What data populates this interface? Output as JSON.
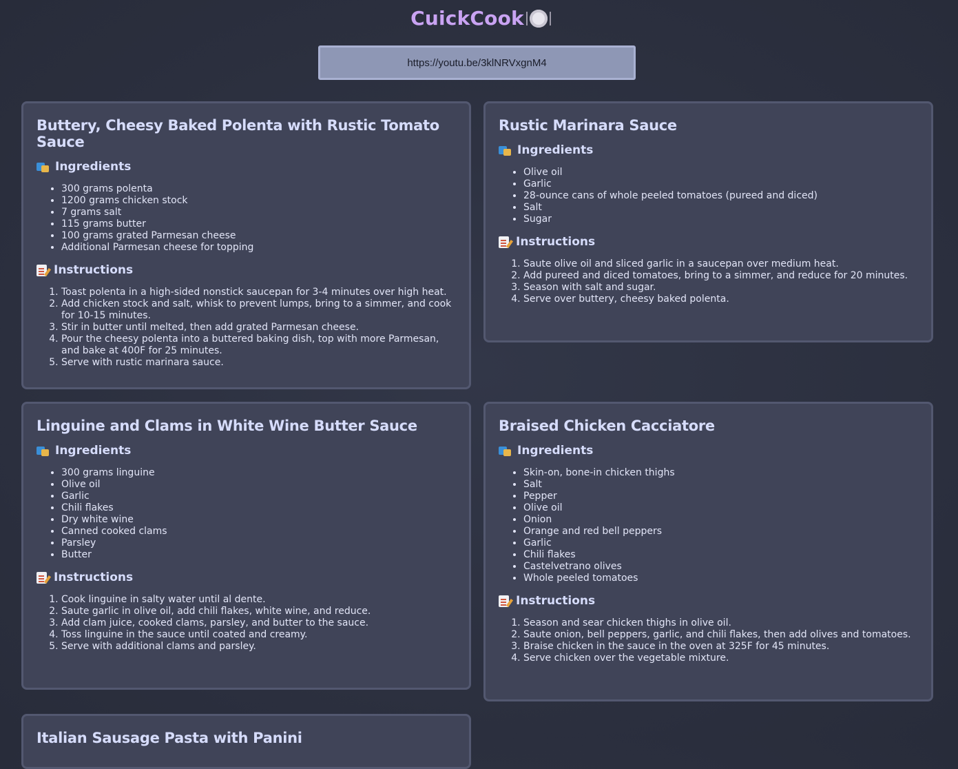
{
  "app": {
    "title": "CuickCook"
  },
  "url_input": {
    "value": "https://youtu.be/3klNRVxgnM4"
  },
  "labels": {
    "ingredients": "Ingredients",
    "instructions": "Instructions"
  },
  "recipes": [
    {
      "title": "Buttery, Cheesy Baked Polenta with Rustic Tomato Sauce",
      "ingredients": [
        "300 grams polenta",
        "1200 grams chicken stock",
        "7 grams salt",
        "115 grams butter",
        "100 grams grated Parmesan cheese",
        "Additional Parmesan cheese for topping"
      ],
      "instructions": [
        "Toast polenta in a high-sided nonstick saucepan for 3-4 minutes over high heat.",
        "Add chicken stock and salt, whisk to prevent lumps, bring to a simmer, and cook for 10-15 minutes.",
        "Stir in butter until melted, then add grated Parmesan cheese.",
        "Pour the cheesy polenta into a buttered baking dish, top with more Parmesan, and bake at 400F for 25 minutes.",
        "Serve with rustic marinara sauce."
      ]
    },
    {
      "title": "Rustic Marinara Sauce",
      "ingredients": [
        "Olive oil",
        "Garlic",
        "28-ounce cans of whole peeled tomatoes (pureed and diced)",
        "Salt",
        "Sugar"
      ],
      "instructions": [
        "Saute olive oil and sliced garlic in a saucepan over medium heat.",
        "Add pureed and diced tomatoes, bring to a simmer, and reduce for 20 minutes.",
        "Season with salt and sugar.",
        "Serve over buttery, cheesy baked polenta."
      ]
    },
    {
      "title": "Linguine and Clams in White Wine Butter Sauce",
      "ingredients": [
        "300 grams linguine",
        "Olive oil",
        "Garlic",
        "Chili flakes",
        "Dry white wine",
        "Canned cooked clams",
        "Parsley",
        "Butter"
      ],
      "instructions": [
        "Cook linguine in salty water until al dente.",
        "Saute garlic in olive oil, add chili flakes, white wine, and reduce.",
        "Add clam juice, cooked clams, parsley, and butter to the sauce.",
        "Toss linguine in the sauce until coated and creamy.",
        "Serve with additional clams and parsley."
      ]
    },
    {
      "title": "Braised Chicken Cacciatore",
      "ingredients": [
        "Skin-on, bone-in chicken thighs",
        "Salt",
        "Pepper",
        "Olive oil",
        "Onion",
        "Orange and red bell peppers",
        "Garlic",
        "Chili flakes",
        "Castelvetrano olives",
        "Whole peeled tomatoes"
      ],
      "instructions": [
        "Season and sear chicken thighs in olive oil.",
        "Saute onion, bell peppers, garlic, and chili flakes, then add olives and tomatoes.",
        "Braise chicken in the sauce in the oven at 325F for 45 minutes.",
        "Serve chicken over the vegetable mixture."
      ]
    },
    {
      "title": "Italian Sausage Pasta with Panini",
      "ingredients": [],
      "instructions": []
    }
  ]
}
